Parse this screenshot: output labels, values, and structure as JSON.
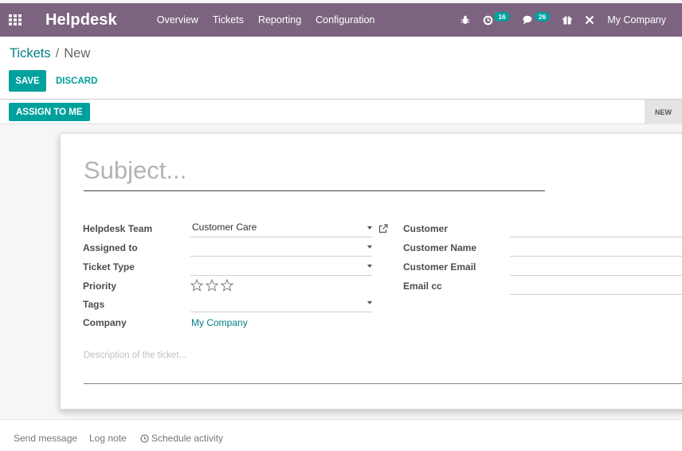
{
  "navbar": {
    "app_name": "Helpdesk",
    "menu": [
      "Overview",
      "Tickets",
      "Reporting",
      "Configuration"
    ],
    "activity_count": "16",
    "messages_count": "26",
    "company": "My Company",
    "icons": [
      "apps-grid-icon",
      "bug-icon",
      "clock-icon",
      "chat-icon",
      "gift-icon",
      "tools-icon"
    ]
  },
  "breadcrumb": {
    "parent": "Tickets",
    "separator": "/",
    "current": "New"
  },
  "buttons": {
    "save": "SAVE",
    "discard": "DISCARD",
    "assign": "ASSIGN TO ME"
  },
  "statusbar": {
    "stage": "NEW"
  },
  "form": {
    "subject_placeholder": "Subject...",
    "left": {
      "helpdesk_team_label": "Helpdesk Team",
      "helpdesk_team_value": "Customer Care",
      "assigned_to_label": "Assigned to",
      "assigned_to_value": "",
      "ticket_type_label": "Ticket Type",
      "ticket_type_value": "",
      "priority_label": "Priority",
      "priority_stars": 0,
      "priority_max": 3,
      "tags_label": "Tags",
      "tags_value": "",
      "company_label": "Company",
      "company_value": "My Company"
    },
    "right": {
      "customer_label": "Customer",
      "customer_name_label": "Customer Name",
      "customer_email_label": "Customer Email",
      "email_cc_label": "Email cc"
    },
    "description_placeholder": "Description of the ticket..."
  },
  "chatter": {
    "send_message": "Send message",
    "log_note": "Log note",
    "schedule_activity": "Schedule activity"
  },
  "colors": {
    "navbar": "#7c6480",
    "primary": "#00a09d",
    "link": "#017e84"
  }
}
